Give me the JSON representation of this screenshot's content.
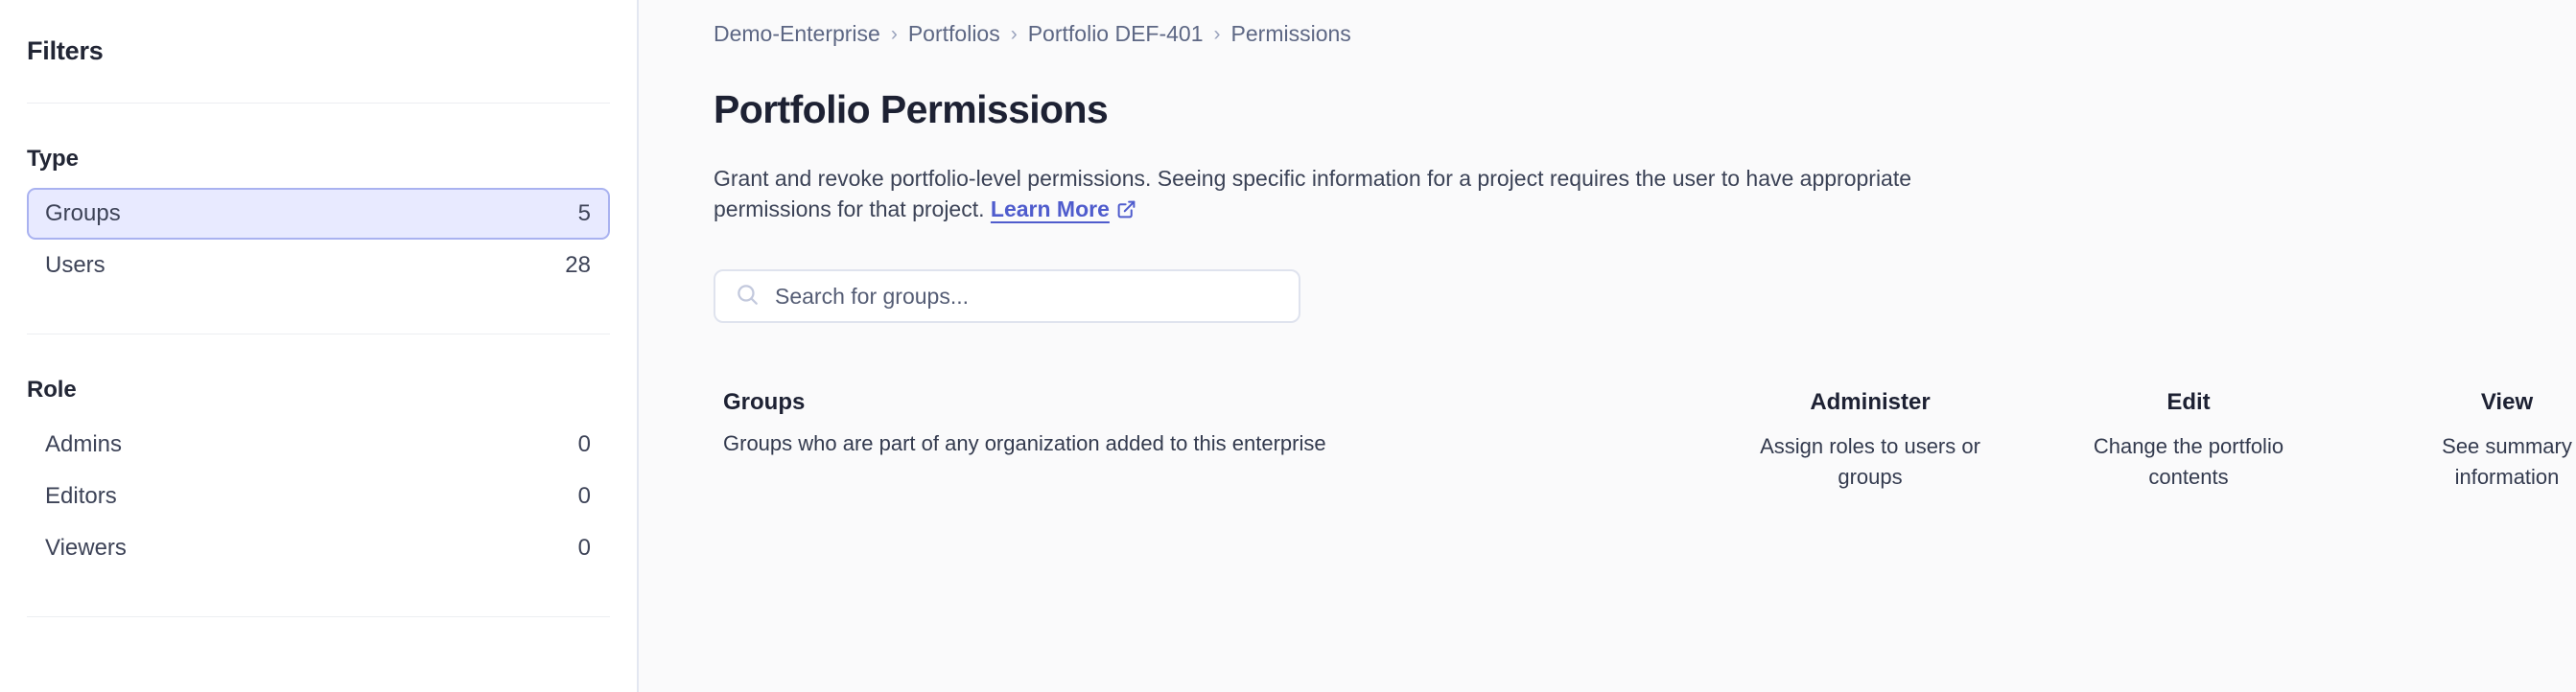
{
  "sidebar": {
    "title": "Filters",
    "sections": [
      {
        "heading": "Type",
        "items": [
          {
            "label": "Groups",
            "count": "5",
            "selected": true
          },
          {
            "label": "Users",
            "count": "28",
            "selected": false
          }
        ]
      },
      {
        "heading": "Role",
        "items": [
          {
            "label": "Admins",
            "count": "0",
            "selected": false
          },
          {
            "label": "Editors",
            "count": "0",
            "selected": false
          },
          {
            "label": "Viewers",
            "count": "0",
            "selected": false
          }
        ]
      }
    ]
  },
  "breadcrumb": {
    "separator": "›",
    "items": [
      {
        "label": "Demo-Enterprise"
      },
      {
        "label": "Portfolios"
      },
      {
        "label": "Portfolio DEF-401"
      },
      {
        "label": "Permissions"
      }
    ]
  },
  "page": {
    "title": "Portfolio Permissions",
    "description_part1": "Grant and revoke portfolio-level permissions. Seeing specific information for a project requires the user to have appropriate permissions for that project. ",
    "learn_more_label": "Learn More",
    "learn_more_icon": "external-link-icon"
  },
  "search": {
    "placeholder": "Search for groups...",
    "value": "",
    "icon": "search-icon"
  },
  "table": {
    "columns": [
      {
        "title": "Groups",
        "subtitle": "Groups who are part of any organization added to this enterprise"
      },
      {
        "title": "Administer",
        "subtitle": "Assign roles to users or groups"
      },
      {
        "title": "Edit",
        "subtitle": "Change the portfolio contents"
      },
      {
        "title": "View",
        "subtitle": "See summary information"
      }
    ]
  },
  "colors": {
    "accent": "#4f5ccd",
    "selected_bg": "#e8eaff",
    "selected_border": "#a9b2f0",
    "page_bg": "#fafafb",
    "sidebar_bg": "#ffffff",
    "text": "#232738"
  }
}
